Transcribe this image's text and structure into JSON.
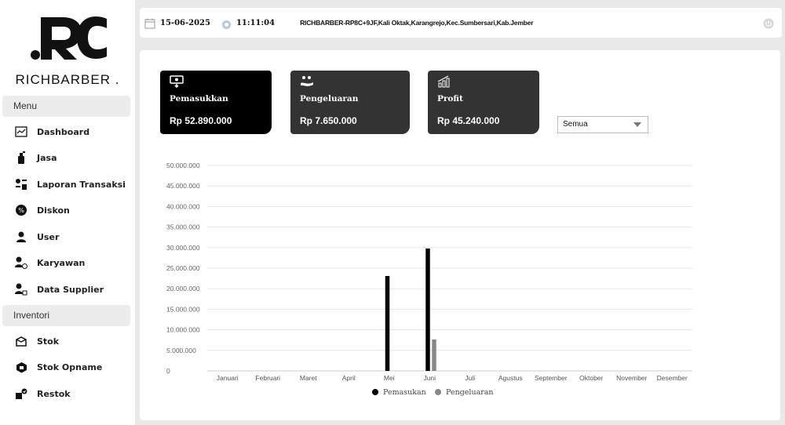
{
  "sidebar": {
    "brand": "RICHBARBER .",
    "sections": [
      {
        "label": "Menu",
        "items": [
          {
            "label": "Dashboard",
            "icon": "chart-line-icon"
          },
          {
            "label": "Jasa",
            "icon": "spray-bottle-icon"
          },
          {
            "label": "Laporan Transaksi",
            "icon": "transaction-report-icon"
          },
          {
            "label": "Diskon",
            "icon": "discount-icon"
          },
          {
            "label": "User",
            "icon": "user-icon"
          },
          {
            "label": "Karyawan",
            "icon": "employee-icon"
          },
          {
            "label": "Data Supplier",
            "icon": "supplier-icon"
          }
        ]
      },
      {
        "label": "Inventori",
        "items": [
          {
            "label": "Stok",
            "icon": "box-icon"
          },
          {
            "label": "Stok Opname",
            "icon": "stock-opname-icon"
          },
          {
            "label": "Restok",
            "icon": "restock-icon"
          }
        ]
      }
    ]
  },
  "topbar": {
    "date": "15-06-2025",
    "time": "11:11:04",
    "address": "RICHBARBER-RP8C+9JF,Kali Oktak,Karangrejo,Kec.Sumbersari,Kab.Jember"
  },
  "cards": [
    {
      "title": "Pemasukkan",
      "value": "Rp 52.890.000",
      "icon": "income-icon"
    },
    {
      "title": "Pengeluaran",
      "value": "Rp 7.650.000",
      "icon": "expense-icon"
    },
    {
      "title": "Profit",
      "value": "Rp 45.240.000",
      "icon": "profit-icon"
    }
  ],
  "filter": {
    "selected": "Semua"
  },
  "colors": {
    "income": "#000000",
    "expense": "#888888"
  },
  "chart_data": {
    "type": "bar",
    "categories": [
      "Januari",
      "Februari",
      "Maret",
      "April",
      "Mei",
      "Juni",
      "Juli",
      "Agustus",
      "September",
      "Oktober",
      "November",
      "Desember"
    ],
    "series": [
      {
        "name": "Pemasukan",
        "values": [
          0,
          0,
          0,
          0,
          23100000,
          29790000,
          0,
          0,
          0,
          0,
          0,
          0
        ]
      },
      {
        "name": "Pengeluaran",
        "values": [
          0,
          0,
          0,
          0,
          0,
          7650000,
          0,
          0,
          0,
          0,
          0,
          0
        ]
      }
    ],
    "yticks": [
      "0",
      "5.000.000",
      "10.000.000",
      "15.000.000",
      "20.000.000",
      "25.000.000",
      "30.000.000",
      "35.000.000",
      "40.000.000",
      "45.000.000",
      "50.000.000"
    ],
    "ylim": [
      0,
      50000000
    ],
    "grid": true,
    "legend": "bottom"
  }
}
